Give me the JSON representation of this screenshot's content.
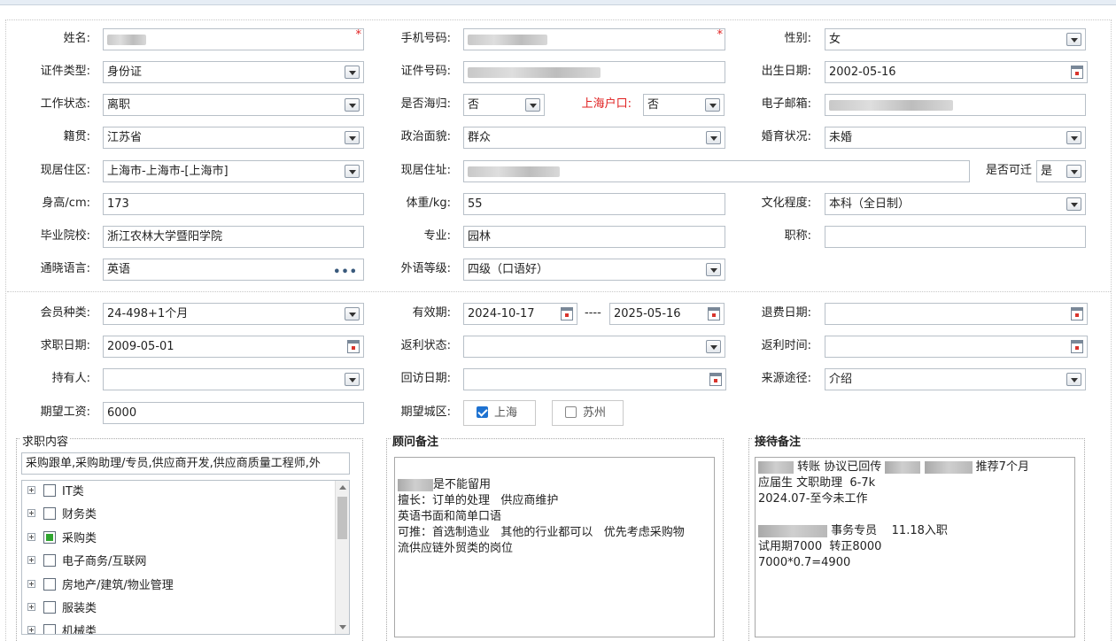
{
  "labels": {
    "name": "姓名:",
    "phone": "手机号码:",
    "gender": "性别:",
    "id_type": "证件类型:",
    "id_no": "证件号码:",
    "birth": "出生日期:",
    "work_status": "工作状态:",
    "returnee": "是否海归:",
    "sh_hukou": "上海户口:",
    "email": "电子邮箱:",
    "native": "籍贯:",
    "political": "政治面貌:",
    "marital": "婚育状况:",
    "residence_area": "现居住区:",
    "residence_addr": "现居住址:",
    "relocate": "是否可迁",
    "height": "身高/cm:",
    "weight": "体重/kg:",
    "education": "文化程度:",
    "school": "毕业院校:",
    "major": "专业:",
    "title": "职称:",
    "language": "通晓语言:",
    "lang_level": "外语等级:",
    "member_type": "会员种类:",
    "validity": "有效期:",
    "refund_date": "退费日期:",
    "job_date": "求职日期:",
    "rebate_status": "返利状态:",
    "rebate_time": "返利时间:",
    "holder": "持有人:",
    "visit_date": "回访日期:",
    "source": "来源途径:",
    "salary": "期望工资:",
    "city": "期望城区:"
  },
  "values": {
    "gender": "女",
    "id_type": "身份证",
    "birth": "2002-05-16",
    "work_status": "离职",
    "returnee": "否",
    "sh_hukou": "否",
    "native": "江苏省",
    "political": "群众",
    "marital": "未婚",
    "residence_area": "上海市-上海市-[上海市]",
    "relocate": "是",
    "height": "173",
    "weight": "55",
    "education": "本科（全日制）",
    "school": "浙江农林大学暨阳学院",
    "major": "园林",
    "title": "",
    "language": "英语",
    "lang_level": "四级（口语好）",
    "member_type": "24-498+1个月",
    "valid_from": "2024-10-17",
    "valid_sep": "----",
    "valid_to": "2025-05-16",
    "refund_date": "",
    "job_date": "2009-05-01",
    "rebate_status": "",
    "rebate_time": "",
    "holder": "",
    "visit_date": "",
    "source": "介绍",
    "salary": "6000",
    "city_options": [
      {
        "label": "上海",
        "checked": true
      },
      {
        "label": "苏州",
        "checked": false
      }
    ]
  },
  "required_mark": "*",
  "lang_picker_glyph": "•••",
  "job_panel": {
    "title": "求职内容",
    "summary": "采购跟单,采购助理/专员,供应商开发,供应商质量工程师,外",
    "tree": [
      {
        "label": "IT类",
        "state": "unchecked"
      },
      {
        "label": "财务类",
        "state": "unchecked"
      },
      {
        "label": "采购类",
        "state": "partial"
      },
      {
        "label": "电子商务/互联网",
        "state": "unchecked"
      },
      {
        "label": "房地产/建筑/物业管理",
        "state": "unchecked"
      },
      {
        "label": "服装类",
        "state": "unchecked"
      },
      {
        "label": "机械类",
        "state": "unchecked"
      }
    ]
  },
  "advisor_panel": {
    "title": "顾问备注",
    "line1_suffix": "是不能留用",
    "lines": [
      "擅长：订单的处理   供应商维护",
      "英语书面和简单口语",
      "可推：首选制造业   其他的行业都可以   优先考虑采购物",
      "流供应链外贸类的岗位"
    ]
  },
  "reception_panel": {
    "title": "接待备注",
    "line1_a": " 转账 协议已回传 ",
    "line1_b": " 推荐7个月",
    "line2": "应届生 文职助理  6-7k",
    "line3": "2024.07-至今未工作",
    "line5_suffix": " 事务专员    11.18入职",
    "line6": "试用期7000  转正8000",
    "line7": "7000*0.7=4900"
  }
}
